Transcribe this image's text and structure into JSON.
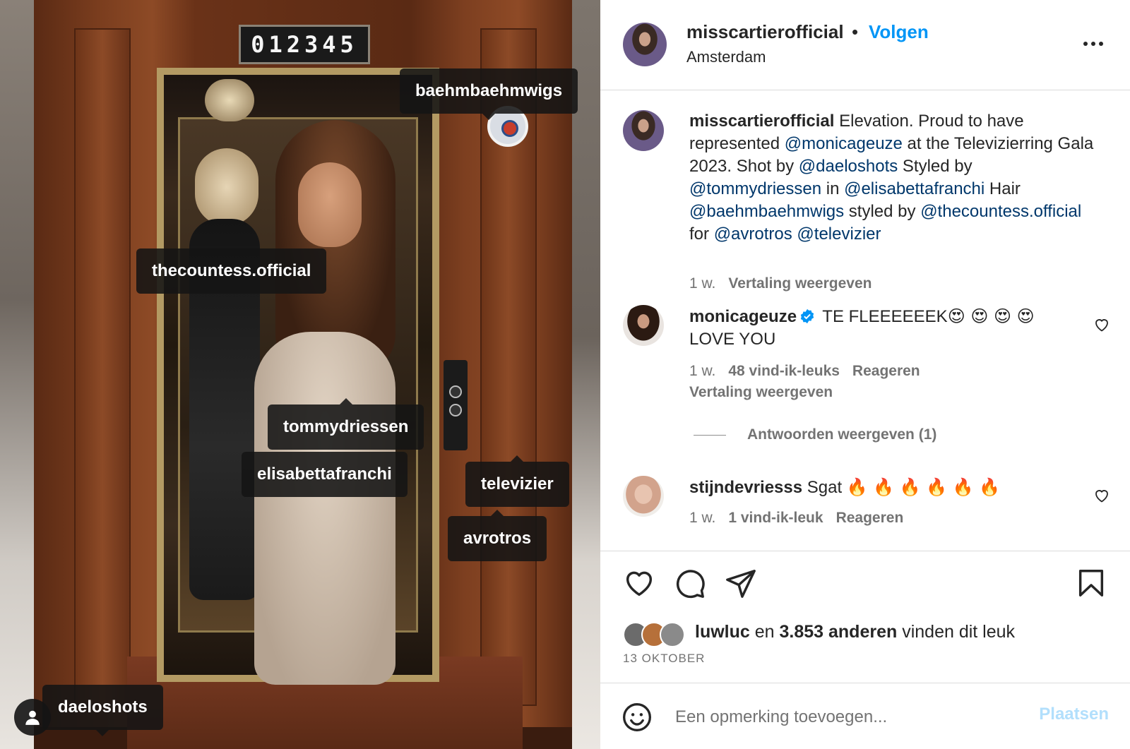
{
  "photo": {
    "floor_number": "012345",
    "tags": {
      "t1": "baehmbaehmwigs",
      "t2": "thecountess.official",
      "t3": "tommydriessen",
      "t4": "elisabettafranchi",
      "t5": "televizier",
      "t6": "avrotros",
      "t7": "daeloshots"
    }
  },
  "header": {
    "username": "misscartierofficial",
    "separator": "•",
    "follow_label": "Volgen",
    "location": "Amsterdam"
  },
  "caption": {
    "username": "misscartierofficial",
    "parts": {
      "p1": " Elevation. Proud to have represented ",
      "m1": "@monicageuze",
      "p2": " at the Televizierring Gala 2023. Shot by ",
      "m2": "@daeloshots",
      "p3": " Styled by ",
      "m3": "@tommydriessen",
      "p4": " in ",
      "m4": "@elisabettafranchi",
      "p5": " Hair ",
      "m5": "@baehmbaehmwigs",
      "p6": " styled by ",
      "m6": "@thecountess.official",
      "p7": " for ",
      "m7": "@avrotros",
      "p8": " ",
      "m8": "@televizier"
    },
    "time": "1 w.",
    "translate": "Vertaling weergeven"
  },
  "comments": [
    {
      "username": "monicageuze",
      "text": " TE FLEEEEEEK",
      "emojis": "😍 😍 😍 😍",
      "text2": "LOVE YOU",
      "time": "1 w.",
      "likes": "48 vind-ik-leuks",
      "reply": "Reageren",
      "translate": "Vertaling weergeven",
      "view_replies": "Antwoorden weergeven (1)"
    },
    {
      "username": "stijndevriesss",
      "text": " Sgat ",
      "emojis": "🔥 🔥 🔥 🔥 🔥 🔥",
      "time": "1 w.",
      "likes": "1 vind-ik-leuk",
      "reply": "Reageren"
    }
  ],
  "likes": {
    "first": "luwluc",
    "connector": " en ",
    "others": "3.853 anderen",
    "suffix": " vinden dit leuk"
  },
  "date": "13 OKTOBER",
  "add_comment": {
    "placeholder": "Een opmerking toevoegen...",
    "post_label": "Plaatsen"
  },
  "colors": {
    "link_blue": "#0095f6",
    "mention_blue": "#00376b",
    "verified_blue": "#0095f6",
    "post_disabled": "#b2dffc"
  },
  "icons": {
    "more": "more-options-icon",
    "like": "heart-icon",
    "comment": "comment-bubble-icon",
    "share": "paper-plane-icon",
    "save": "bookmark-icon",
    "emoji": "smiley-icon",
    "verified": "verified-badge-icon",
    "user_tags": "person-icon"
  }
}
